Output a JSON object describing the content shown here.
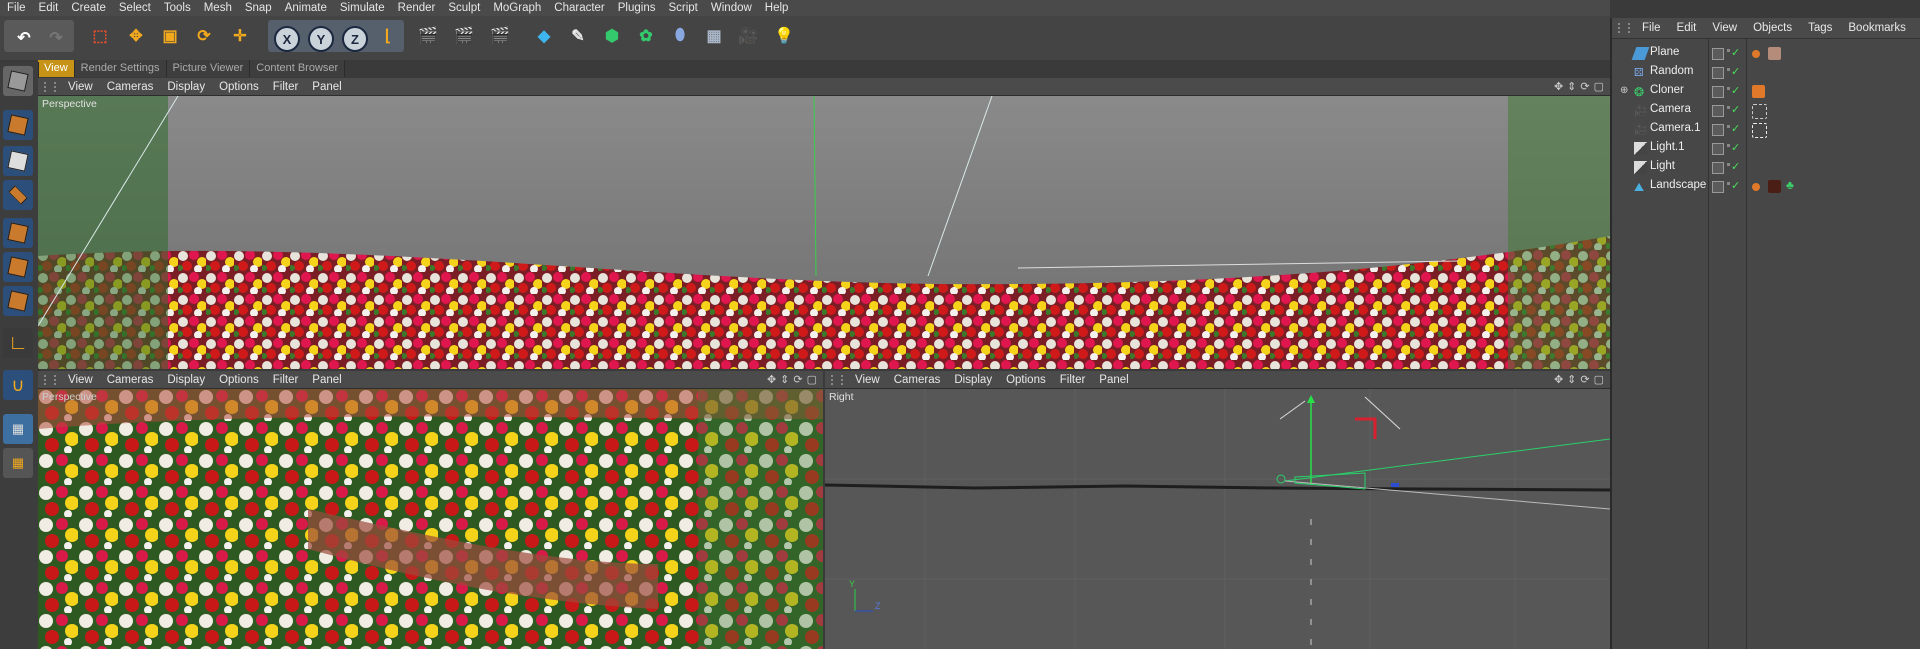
{
  "menubar": {
    "items": [
      "File",
      "Edit",
      "Create",
      "Select",
      "Tools",
      "Mesh",
      "Snap",
      "Animate",
      "Simulate",
      "Render",
      "Sculpt",
      "MoGraph",
      "Character",
      "Plugins",
      "Script",
      "Window",
      "Help"
    ]
  },
  "toolbar": {
    "axis_x": "X",
    "axis_y": "Y",
    "axis_z": "Z"
  },
  "doc_tabs": [
    "View",
    "Render Settings",
    "Picture Viewer",
    "Content Browser"
  ],
  "viewport_top": {
    "menu": [
      "View",
      "Cameras",
      "Display",
      "Options",
      "Filter",
      "Panel"
    ],
    "label": "Perspective"
  },
  "viewport_bl": {
    "menu": [
      "View",
      "Cameras",
      "Display",
      "Options",
      "Filter",
      "Panel"
    ],
    "label": "Perspective"
  },
  "viewport_br": {
    "menu": [
      "View",
      "Cameras",
      "Display",
      "Options",
      "Filter",
      "Panel"
    ],
    "label": "Right",
    "axis_y": "Y",
    "axis_z": "Z"
  },
  "objects_panel": {
    "menu": [
      "File",
      "Edit",
      "View",
      "Objects",
      "Tags",
      "Bookmarks"
    ],
    "objects": [
      "Plane",
      "Random",
      "Cloner",
      "Camera",
      "Camera.1",
      "Light.1",
      "Light",
      "Landscape"
    ]
  },
  "colors": {
    "accent_tab": "#c79316",
    "check_green": "#4ae05a"
  }
}
